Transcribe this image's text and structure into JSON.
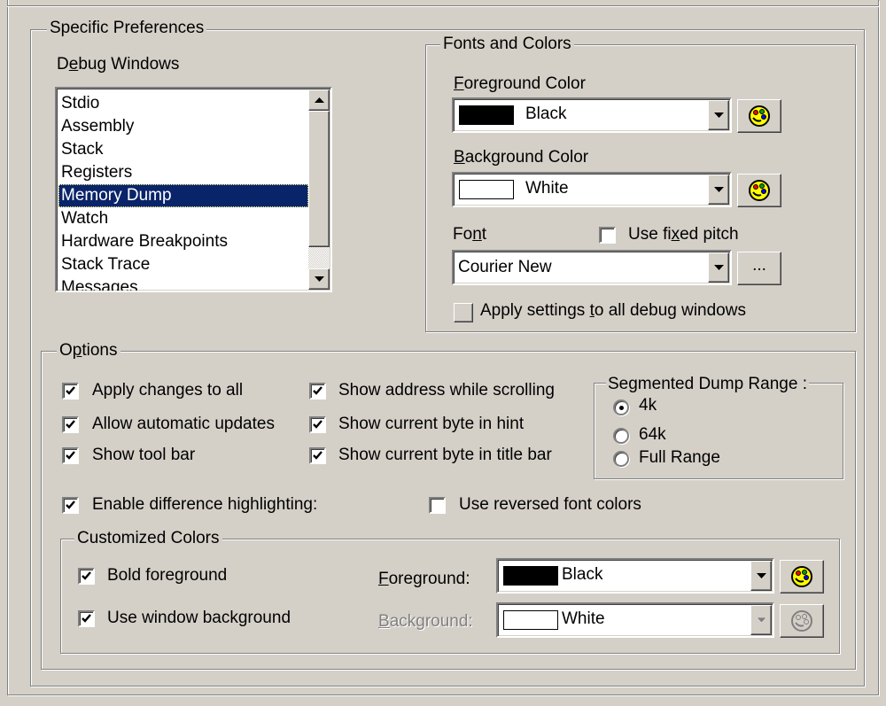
{
  "specific_preferences": {
    "title": "Specific Preferences",
    "debug_windows": {
      "label_pre": "D",
      "label_u": "e",
      "label_post": "bug Windows",
      "items": [
        "Stdio",
        "Assembly",
        "Stack",
        "Registers",
        "Memory Dump",
        "Watch",
        "Hardware Breakpoints",
        "Stack Trace",
        "Messages"
      ],
      "selected": "Memory Dump"
    },
    "fonts_and_colors": {
      "title": "Fonts and Colors",
      "foreground_label_u": "F",
      "foreground_label_post": "oreground Color",
      "foreground_value": "Black",
      "foreground_swatch": "#000000",
      "background_label_u": "B",
      "background_label_post": "ackground Color",
      "background_value": "White",
      "background_swatch": "#ffffff",
      "font_label_pre": "Fo",
      "font_label_u": "n",
      "font_label_post": "t",
      "fixed_pitch_pre": "Use fi",
      "fixed_pitch_u": "x",
      "fixed_pitch_post": "ed pitch",
      "fixed_pitch_checked": false,
      "font_value": "Courier New",
      "font_browse_label": "...",
      "apply_all_pre": "Apply settings ",
      "apply_all_u": "t",
      "apply_all_post": "o all debug windows"
    }
  },
  "options": {
    "title_pre": "O",
    "title_u": "p",
    "title_post": "tions",
    "checks": [
      {
        "label": "Apply changes to all",
        "checked": true
      },
      {
        "label": "Allow automatic updates",
        "checked": true
      },
      {
        "label": "Show tool bar",
        "checked": true
      },
      {
        "label": "Show address while scrolling",
        "checked": true
      },
      {
        "label": "Show current byte in hint",
        "checked": true
      },
      {
        "label": "Show current byte in title bar",
        "checked": true
      }
    ],
    "segmented": {
      "title": "Segmented Dump Range :",
      "options": [
        "4k",
        "64k",
        "Full Range"
      ],
      "selected": "4k"
    },
    "difference_highlighting": {
      "label": "Enable difference highlighting:",
      "checked": true
    },
    "reversed_font_colors": {
      "label": "Use reversed font colors",
      "checked": false
    },
    "customized_colors": {
      "title": "Customized Colors",
      "bold_foreground": {
        "label": "Bold foreground",
        "checked": true
      },
      "use_window_background": {
        "label": "Use window background",
        "checked": true
      },
      "foreground_label_u": "F",
      "foreground_label_post": "oreground:",
      "foreground_value": "Black",
      "foreground_swatch": "#000000",
      "background_label_u": "B",
      "background_label_post": "ackground:",
      "background_value": "White",
      "background_swatch": "#ffffff"
    }
  }
}
